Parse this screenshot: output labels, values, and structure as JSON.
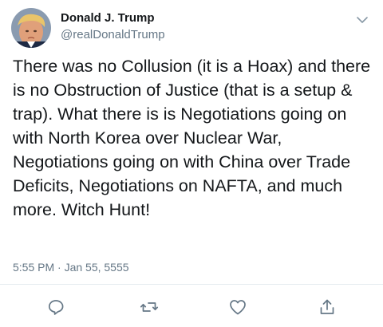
{
  "user": {
    "display_name": "Donald J. Trump",
    "handle": "@realDonaldTrump"
  },
  "tweet": {
    "text": "There was no Collusion (it is a Hoax) and there is no Obstruction of Justice (that is a setup & trap). What there is is Negotiations going on with North Korea over Nuclear War, Negotiations going on with China over Trade Deficits, Negotiations on NAFTA, and much more. Witch Hunt!",
    "timestamp": "5:55 PM · Jan 55, 5555"
  },
  "icons": {
    "menu": "chevron-down-icon",
    "reply": "reply-icon",
    "retweet": "retweet-icon",
    "like": "heart-icon",
    "share": "share-icon"
  },
  "colors": {
    "text": "#14171a",
    "secondary": "#657786",
    "icon": "#657786",
    "divider": "#e6ecf0"
  }
}
